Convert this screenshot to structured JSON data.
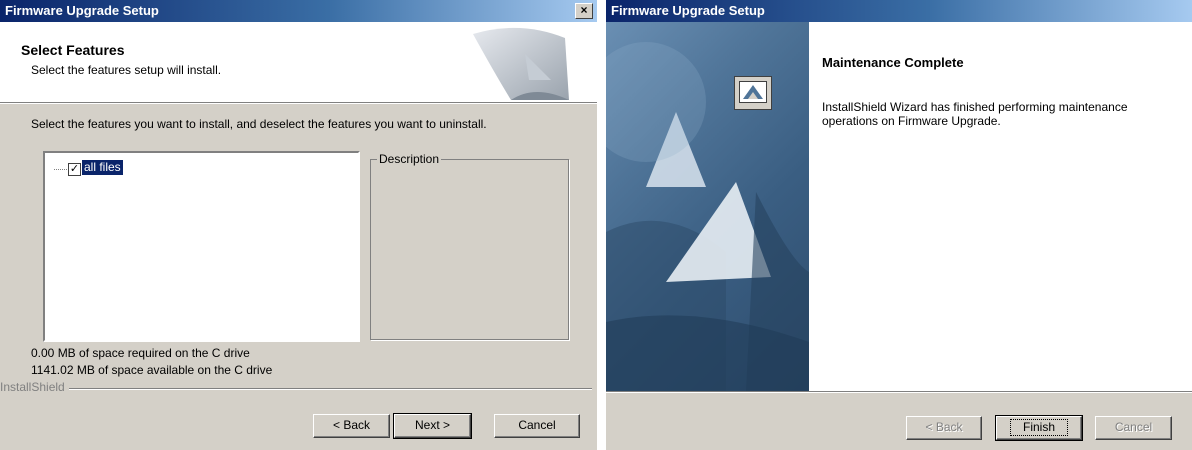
{
  "left_window": {
    "title": "Firmware Upgrade Setup",
    "close_glyph": "×",
    "header_title": "Select Features",
    "header_subtitle": "Select the features setup will install.",
    "instruction": "Select the features you want to install, and deselect the features you want to uninstall.",
    "tree_item": {
      "label": "all files",
      "checked": true
    },
    "description_label": "Description",
    "space_required": "0.00 MB of space required on the C drive",
    "space_available": "1141.02 MB of space available on the C drive",
    "brand": "InstallShield",
    "buttons": {
      "back": "< Back",
      "next": "Next >",
      "cancel": "Cancel"
    }
  },
  "right_window": {
    "title": "Firmware Upgrade Setup",
    "heading": "Maintenance Complete",
    "body": "InstallShield Wizard has finished performing maintenance operations on Firmware Upgrade.",
    "buttons": {
      "back": "< Back",
      "finish": "Finish",
      "cancel": "Cancel"
    }
  },
  "colors": {
    "titlebar_start": "#0a246a",
    "titlebar_end": "#a6caf0",
    "dialog_face": "#d4d0c8",
    "selection": "#0a246a",
    "panel_blue": "#4f7498"
  },
  "icons": [
    "close-icon",
    "checkbox-icon",
    "installshield-graphic-icon",
    "monitor-icon",
    "sail-art-graphic"
  ]
}
